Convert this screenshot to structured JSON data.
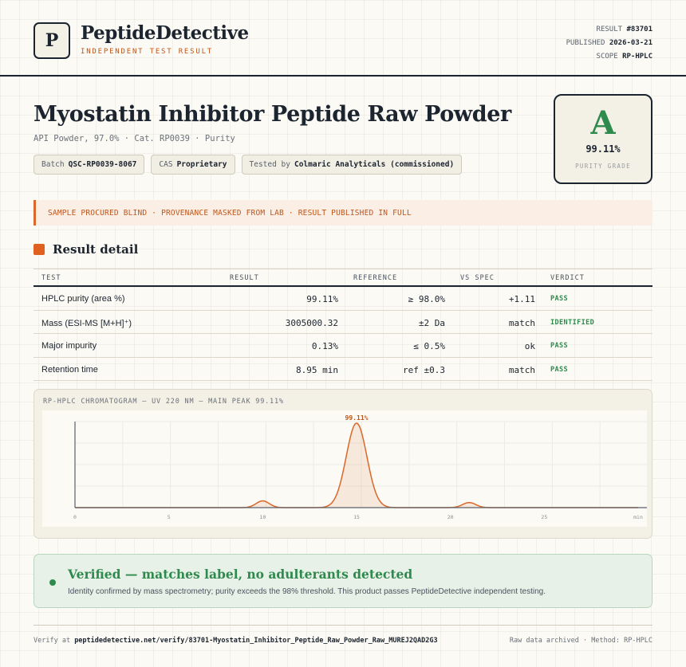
{
  "header": {
    "logo_letter": "P",
    "brand": "PeptideDetective",
    "brand_sub": "INDEPENDENT TEST RESULT",
    "meta": [
      {
        "label": "RESULT",
        "value": "#83701"
      },
      {
        "label": "PUBLISHED",
        "value": "2026-03-21"
      },
      {
        "label": "SCOPE",
        "value": "RP-HPLC"
      }
    ]
  },
  "product": {
    "title": "Myostatin Inhibitor Peptide Raw Powder",
    "subtitle": "API Powder, 97.0% · Cat. RP0039 · Purity",
    "chips": [
      {
        "label": "Batch",
        "value": "QSC-RP0039-8067"
      },
      {
        "label": "CAS",
        "value": "Proprietary"
      },
      {
        "label": "Tested by",
        "value": "Colmaric Analyticals (commissioned)"
      }
    ]
  },
  "grade": {
    "letter": "A",
    "value": "99.11%",
    "label": "PURITY GRADE",
    "color": "#2f8a4e"
  },
  "banner": "SAMPLE PROCURED BLIND · PROVENANCE MASKED FROM LAB · RESULT PUBLISHED IN FULL",
  "section_title": "Result detail",
  "table": {
    "headers": [
      "TEST",
      "RESULT",
      "REFERENCE",
      "VS SPEC",
      "VERDICT"
    ],
    "rows": [
      {
        "test": "HPLC purity (area %)",
        "result": "99.11%",
        "reference": "≥ 98.0%",
        "vs_spec": "+1.11",
        "verdict": "PASS"
      },
      {
        "test": "Mass (ESI-MS [M+H]⁺)",
        "result": "3005000.32",
        "reference": "±2 Da",
        "vs_spec": "match",
        "verdict": "IDENTIFIED"
      },
      {
        "test": "Major impurity",
        "result": "0.13%",
        "reference": "≤ 0.5%",
        "vs_spec": "ok",
        "verdict": "PASS"
      },
      {
        "test": "Retention time",
        "result": "8.95 min",
        "reference": "ref ±0.3",
        "vs_spec": "match",
        "verdict": "PASS"
      }
    ]
  },
  "chart": {
    "title": "RP-HPLC CHROMATOGRAM — UV 220 NM — MAIN PEAK 99.11%",
    "line_color": "#d9682a"
  },
  "chart_data": {
    "type": "line",
    "title": "RP-HPLC CHROMATOGRAM — UV 220 NM — MAIN PEAK 99.11%",
    "xlabel": "",
    "ylabel": "",
    "xlim": [
      0,
      30
    ],
    "x_ticks": [
      "0",
      "5",
      "10",
      "15",
      "20",
      "25",
      "30"
    ],
    "x_tick_labels": [
      "0",
      "5",
      "10",
      "15",
      "20",
      "25",
      "min"
    ],
    "peaks": [
      {
        "center": 10.0,
        "height": 0.08,
        "width": 0.35
      },
      {
        "center": 15.0,
        "height": 1.0,
        "width": 0.55
      },
      {
        "center": 21.0,
        "height": 0.06,
        "width": 0.35
      }
    ],
    "peak_label": "99.11%",
    "grid": true
  },
  "verified": {
    "title": "Verified — matches label, no adulterants detected",
    "text": "Identity confirmed by mass spectrometry; purity exceeds the 98% threshold. This product passes PeptideDetective independent testing."
  },
  "footer": {
    "verify_prefix": "Verify at",
    "verify_url": "peptidedetective.net/verify/83701-Myostatin_Inhibitor_Peptide_Raw_Powder_Raw_MUREJ2QAD2G3",
    "right": "Raw data archived · Method: RP-HPLC"
  }
}
